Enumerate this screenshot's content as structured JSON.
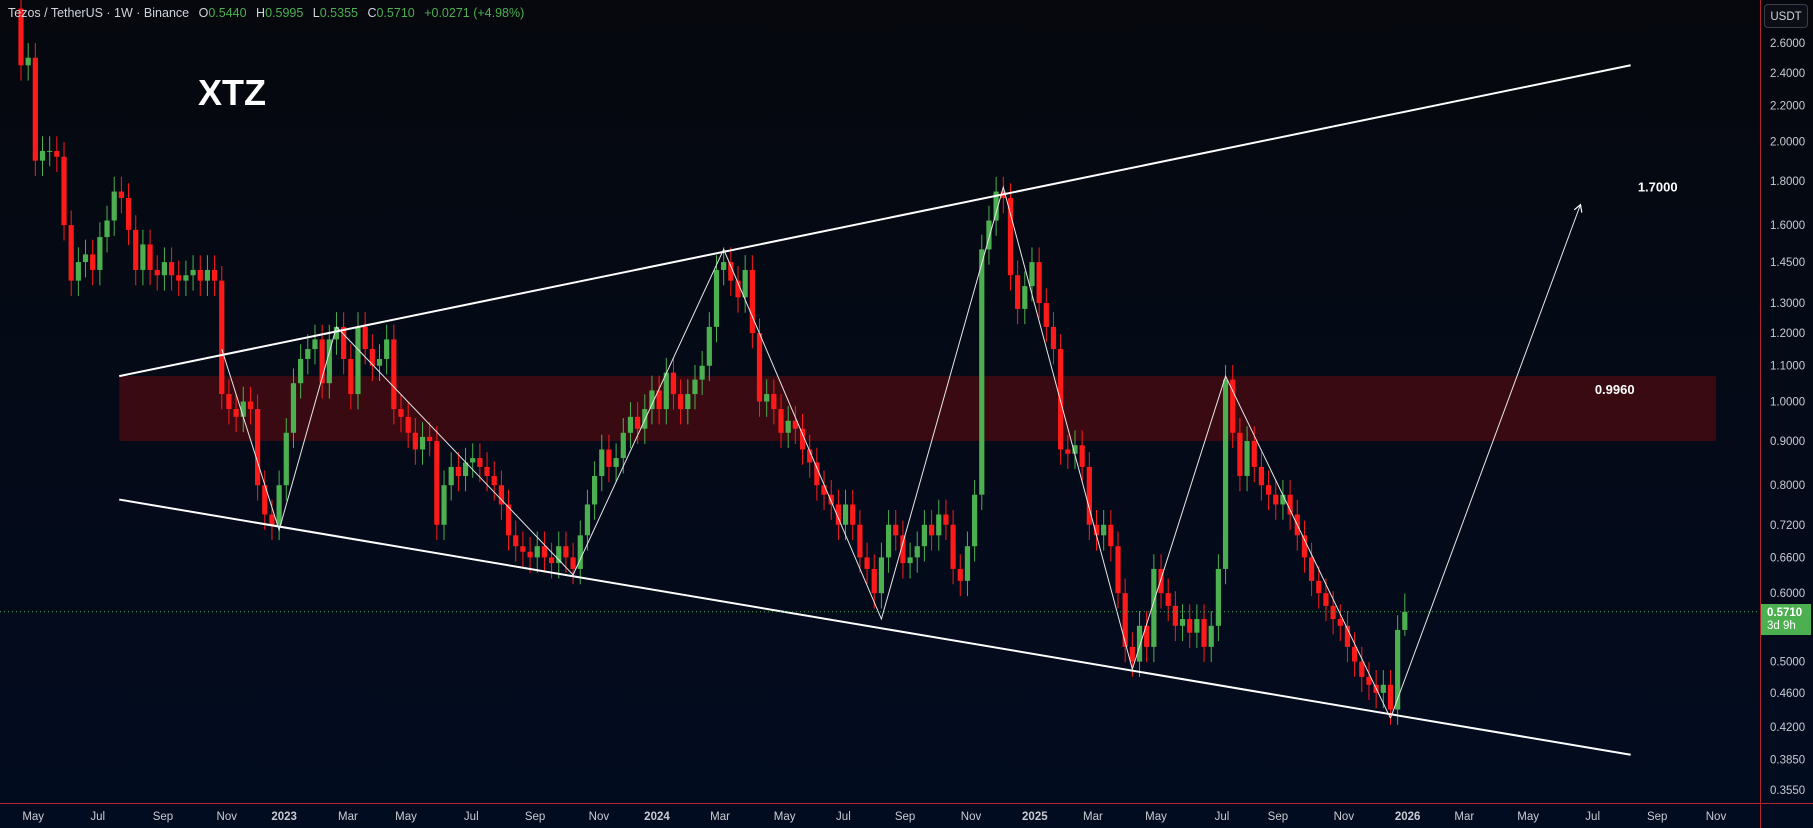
{
  "header": {
    "symbol": "Tezos / TetherUS · 1W · Binance",
    "open_label": "O",
    "open": "0.5440",
    "high_label": "H",
    "high": "0.5995",
    "low_label": "L",
    "low": "0.5355",
    "close_label": "C",
    "close": "0.5710",
    "change": "+0.0271 (+4.98%)"
  },
  "currency_button": "USDT",
  "price_tag": {
    "price": "0.5710",
    "countdown": "3d 9h"
  },
  "colors": {
    "up": "#4caf50",
    "down": "#ff1a1a",
    "zone": "#3a0a12",
    "line": "#ffffff",
    "axis_border": "#b2222a"
  },
  "chart_data": {
    "type": "candlestick",
    "title": "XTZ",
    "scale": "log",
    "ylim": [
      0.34,
      2.9
    ],
    "first_open": 2.85,
    "closes": [
      2.45,
      2.5,
      1.9,
      1.95,
      1.95,
      1.92,
      1.6,
      1.38,
      1.45,
      1.48,
      1.42,
      1.55,
      1.62,
      1.75,
      1.72,
      1.58,
      1.42,
      1.52,
      1.42,
      1.4,
      1.45,
      1.4,
      1.38,
      1.4,
      1.42,
      1.38,
      1.42,
      1.38,
      1.02,
      0.98,
      0.96,
      1.0,
      0.98,
      0.8,
      0.74,
      0.72,
      0.8,
      0.92,
      1.05,
      1.12,
      1.15,
      1.18,
      1.05,
      1.18,
      1.22,
      1.12,
      1.02,
      1.22,
      1.15,
      1.1,
      1.12,
      1.18,
      0.98,
      0.96,
      0.92,
      0.88,
      0.91,
      0.9,
      0.72,
      0.8,
      0.84,
      0.82,
      0.85,
      0.86,
      0.84,
      0.82,
      0.8,
      0.76,
      0.7,
      0.68,
      0.67,
      0.66,
      0.68,
      0.66,
      0.65,
      0.68,
      0.66,
      0.64,
      0.7,
      0.76,
      0.82,
      0.88,
      0.84,
      0.86,
      0.92,
      0.96,
      0.93,
      0.98,
      1.03,
      0.98,
      1.08,
      1.02,
      0.98,
      1.02,
      1.06,
      1.1,
      1.22,
      1.42,
      1.45,
      1.38,
      1.32,
      1.42,
      1.2,
      1.0,
      1.02,
      0.98,
      0.92,
      0.95,
      0.93,
      0.88,
      0.85,
      0.8,
      0.78,
      0.76,
      0.72,
      0.76,
      0.72,
      0.66,
      0.64,
      0.6,
      0.66,
      0.72,
      0.7,
      0.65,
      0.66,
      0.68,
      0.72,
      0.7,
      0.74,
      0.72,
      0.64,
      0.62,
      0.68,
      0.78,
      1.5,
      1.62,
      1.75,
      1.72,
      1.4,
      1.28,
      1.36,
      1.45,
      1.3,
      1.22,
      1.15,
      0.88,
      0.87,
      0.89,
      0.84,
      0.72,
      0.7,
      0.72,
      0.68,
      0.6,
      0.52,
      0.5,
      0.55,
      0.52,
      0.64,
      0.6,
      0.58,
      0.55,
      0.56,
      0.54,
      0.56,
      0.52,
      0.55,
      0.64,
      1.06,
      0.92,
      0.82,
      0.9,
      0.84,
      0.8,
      0.78,
      0.76,
      0.78,
      0.74,
      0.7,
      0.66,
      0.62,
      0.6,
      0.58,
      0.56,
      0.55,
      0.52,
      0.5,
      0.48,
      0.47,
      0.46,
      0.47,
      0.44,
      0.544,
      0.571
    ],
    "last_candle": {
      "open": 0.544,
      "high": 0.5995,
      "low": 0.5355,
      "close": 0.571
    },
    "y_ticks": [
      "2.6000",
      "2.4000",
      "2.2000",
      "2.0000",
      "1.8000",
      "1.6000",
      "1.4500",
      "1.3000",
      "1.2000",
      "1.1000",
      "1.0000",
      "0.9000",
      "0.8000",
      "0.7200",
      "0.6600",
      "0.6000",
      "0.5000",
      "0.4600",
      "0.4200",
      "0.3850",
      "0.3550"
    ],
    "x_ticks": [
      {
        "label": "May",
        "week": 1.7
      },
      {
        "label": "Jul",
        "week": 10.7
      },
      {
        "label": "Sep",
        "week": 19.8
      },
      {
        "label": "Nov",
        "week": 28.7
      },
      {
        "label": "2023",
        "week": 36.7
      },
      {
        "label": "Mar",
        "week": 45.6
      },
      {
        "label": "May",
        "week": 53.7
      },
      {
        "label": "Jul",
        "week": 62.8
      },
      {
        "label": "Sep",
        "week": 71.7
      },
      {
        "label": "Nov",
        "week": 80.6
      },
      {
        "label": "2024",
        "week": 88.7
      },
      {
        "label": "Mar",
        "week": 97.5
      },
      {
        "label": "May",
        "week": 106.5
      },
      {
        "label": "Jul",
        "week": 114.7
      },
      {
        "label": "Sep",
        "week": 123.3
      },
      {
        "label": "Nov",
        "week": 132.5
      },
      {
        "label": "2025",
        "week": 141.4
      },
      {
        "label": "Mar",
        "week": 149.5
      },
      {
        "label": "May",
        "week": 158.3
      },
      {
        "label": "Jul",
        "week": 167.5
      },
      {
        "label": "Sep",
        "week": 175.3
      },
      {
        "label": "Nov",
        "week": 184.5
      },
      {
        "label": "2026",
        "week": 193.4
      },
      {
        "label": "Mar",
        "week": 201.3
      },
      {
        "label": "May",
        "week": 210.2
      },
      {
        "label": "Jul",
        "week": 219.2
      },
      {
        "label": "Sep",
        "week": 228.2
      },
      {
        "label": "Nov",
        "week": 236.4
      }
    ],
    "current_price": 0.571,
    "drawings": {
      "upper_trendline": [
        {
          "week": 13.7,
          "price": 1.07
        },
        {
          "week": 224.5,
          "price": 2.45
        }
      ],
      "lower_trendline": [
        {
          "week": 13.7,
          "price": 0.77
        },
        {
          "week": 224.5,
          "price": 0.39
        }
      ],
      "resistance_zone": {
        "from_week": 13.7,
        "to_week": 236.4,
        "low": 0.9,
        "high": 1.07,
        "label": "0.9960",
        "label_week": 219.5,
        "label_price": 1.02
      },
      "zigzag": [
        {
          "week": 28,
          "price": 1.15
        },
        {
          "week": 36,
          "price": 0.71
        },
        {
          "week": 44,
          "price": 1.22
        },
        {
          "week": 77,
          "price": 0.63
        },
        {
          "week": 98,
          "price": 1.5
        },
        {
          "week": 120,
          "price": 0.56
        },
        {
          "week": 137,
          "price": 1.77
        },
        {
          "week": 155,
          "price": 0.49
        },
        {
          "week": 168,
          "price": 1.07
        },
        {
          "week": 191,
          "price": 0.43
        }
      ],
      "projection_arrow": {
        "from": {
          "week": 191,
          "price": 0.43
        },
        "to": {
          "week": 217.5,
          "price": 1.69
        }
      },
      "target_label": {
        "text": "1.7000",
        "week": 225.5,
        "price": 1.75
      }
    }
  }
}
